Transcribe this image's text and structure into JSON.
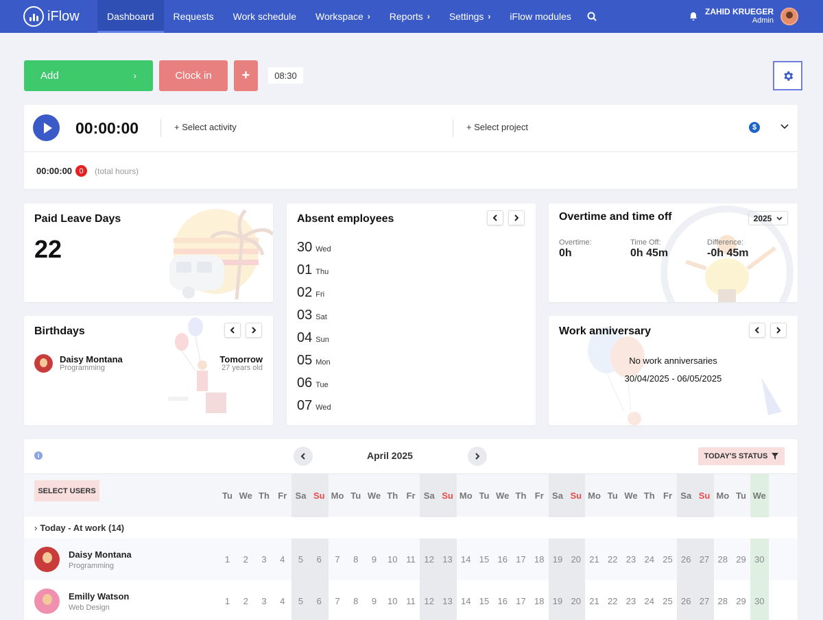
{
  "nav": {
    "brand": "iFlow",
    "items": [
      {
        "label": "Dashboard",
        "active": true,
        "submenu": false
      },
      {
        "label": "Requests",
        "active": false,
        "submenu": false
      },
      {
        "label": "Work schedule",
        "active": false,
        "submenu": false
      },
      {
        "label": "Workspace",
        "active": false,
        "submenu": true
      },
      {
        "label": "Reports",
        "active": false,
        "submenu": true
      },
      {
        "label": "Settings",
        "active": false,
        "submenu": true
      },
      {
        "label": "iFlow modules",
        "active": false,
        "submenu": false
      }
    ],
    "user_name": "ZAHID KRUEGER",
    "user_role": "Admin"
  },
  "actions": {
    "add_label": "Add",
    "clock_in_label": "Clock in",
    "plus_label": "+",
    "time": "08:30"
  },
  "timer": {
    "value": "00:00:00",
    "select_activity": "Select activity",
    "select_project": "Select project",
    "total_value": "00:00:00",
    "total_count": "0",
    "total_label": "(total hours)"
  },
  "paid_leave": {
    "title": "Paid Leave Days",
    "value": "22"
  },
  "absent": {
    "title": "Absent employees",
    "days": [
      {
        "day": "30",
        "weekday": "Wed"
      },
      {
        "day": "01",
        "weekday": "Thu"
      },
      {
        "day": "02",
        "weekday": "Fri"
      },
      {
        "day": "03",
        "weekday": "Sat"
      },
      {
        "day": "04",
        "weekday": "Sun"
      },
      {
        "day": "05",
        "weekday": "Mon"
      },
      {
        "day": "06",
        "weekday": "Tue"
      },
      {
        "day": "07",
        "weekday": "Wed"
      }
    ]
  },
  "overtime": {
    "title": "Overtime and time off",
    "year": "2025",
    "overtime_label": "Overtime:",
    "overtime_value": "0h",
    "timeoff_label": "Time Off:",
    "timeoff_value": "0h 45m",
    "difference_label": "Difference:",
    "difference_value": "-0h 45m"
  },
  "birthdays": {
    "title": "Birthdays",
    "name": "Daisy Montana",
    "dept": "Programming",
    "when": "Tomorrow",
    "age": "27 years old"
  },
  "anniversary": {
    "title": "Work anniversary",
    "message": "No work anniversaries",
    "range": "30/04/2025 - 06/05/2025"
  },
  "calendar": {
    "month": "April 2025",
    "today_status_label": "TODAY'S STATUS",
    "select_users_label": "SELECT USERS",
    "group_label": "Today - At work (14)",
    "days": [
      {
        "num": "1",
        "wd": "Tu"
      },
      {
        "num": "2",
        "wd": "We"
      },
      {
        "num": "3",
        "wd": "Th"
      },
      {
        "num": "4",
        "wd": "Fr"
      },
      {
        "num": "5",
        "wd": "Sa"
      },
      {
        "num": "6",
        "wd": "Su"
      },
      {
        "num": "7",
        "wd": "Mo"
      },
      {
        "num": "8",
        "wd": "Tu"
      },
      {
        "num": "9",
        "wd": "We"
      },
      {
        "num": "10",
        "wd": "Th"
      },
      {
        "num": "11",
        "wd": "Fr"
      },
      {
        "num": "12",
        "wd": "Sa"
      },
      {
        "num": "13",
        "wd": "Su"
      },
      {
        "num": "14",
        "wd": "Mo"
      },
      {
        "num": "15",
        "wd": "Tu"
      },
      {
        "num": "16",
        "wd": "We"
      },
      {
        "num": "17",
        "wd": "Th"
      },
      {
        "num": "18",
        "wd": "Fr"
      },
      {
        "num": "19",
        "wd": "Sa"
      },
      {
        "num": "20",
        "wd": "Su"
      },
      {
        "num": "21",
        "wd": "Mo"
      },
      {
        "num": "22",
        "wd": "Tu"
      },
      {
        "num": "23",
        "wd": "We"
      },
      {
        "num": "24",
        "wd": "Th"
      },
      {
        "num": "25",
        "wd": "Fr"
      },
      {
        "num": "26",
        "wd": "Sa"
      },
      {
        "num": "27",
        "wd": "Su"
      },
      {
        "num": "28",
        "wd": "Mo"
      },
      {
        "num": "29",
        "wd": "Tu"
      },
      {
        "num": "30",
        "wd": "We"
      }
    ],
    "today": "30",
    "employees": [
      {
        "name": "Daisy Montana",
        "dept": "Programming",
        "avatar_color": "#c93c3c"
      },
      {
        "name": "Emilly Watson",
        "dept": "Web Design",
        "avatar_color": "#f08fae"
      }
    ]
  },
  "colors": {
    "nav": "#3a5bc7",
    "add": "#3ec96c",
    "clock_in": "#e98080",
    "weekend_sunday": "#e84c4c"
  }
}
